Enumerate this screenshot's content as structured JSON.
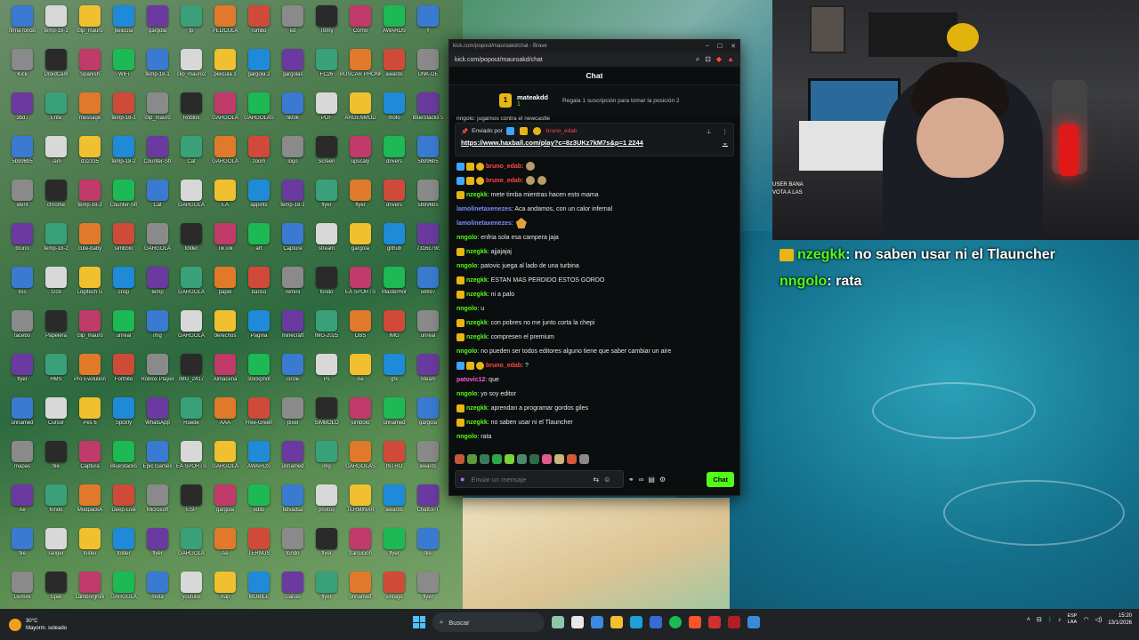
{
  "browser": {
    "title": "kick.com/popout/mauroakd/chat - Brave",
    "url": "kick.com/popout/mauroakd/chat"
  },
  "chat": {
    "header": "Chat",
    "top_gifter": {
      "name": "mateakdd",
      "count": "1",
      "promo": "Regala 1 suscripción para tomar la posición 2"
    },
    "old_line": "nngolo: jugamos contra el newcastle",
    "pinned": {
      "label": "Enviado por",
      "user": "bruno_edab",
      "link": "https://www.haxball.com/play?c=8z3UKz7kM7s&p=1 2244"
    },
    "messages": [
      {
        "user": "bruno_edab",
        "color": "#ff4747",
        "badges": [
          "blue",
          "crown",
          "coin"
        ],
        "text": ":",
        "emote": "emote"
      },
      {
        "user": "bruno_edab",
        "color": "#ff4747",
        "badges": [
          "blue",
          "crown",
          "coin"
        ],
        "text": ":",
        "emote": "emote2x"
      },
      {
        "user": "nzegkk",
        "color": "#53fc18",
        "badges": [
          "crown"
        ],
        "text": ": mete timba mientras hacen esto mama",
        "emote": ""
      },
      {
        "user": "lamolinetaxenezes",
        "color": "#7b8cff",
        "badges": [],
        "text": ": Aca andamos, con un calor infernal",
        "emote": ""
      },
      {
        "user": "lamolinetaxenezes",
        "color": "#7b8cff",
        "badges": [],
        "text": ":",
        "emote": "bird"
      },
      {
        "user": "nngolo",
        "color": "#53fc18",
        "badges": [],
        "text": ": enfria sola esa campera jaja",
        "emote": ""
      },
      {
        "user": "nzegkk",
        "color": "#53fc18",
        "badges": [
          "crown"
        ],
        "text": ": ajjajajaj",
        "emote": ""
      },
      {
        "user": "nngolo",
        "color": "#53fc18",
        "badges": [],
        "text": ": patovic juega al lado de una turbina",
        "emote": ""
      },
      {
        "user": "nzegkk",
        "color": "#53fc18",
        "badges": [
          "crown"
        ],
        "text": ": ESTAN MAS PERDIDO ESTOS GORDO",
        "emote": ""
      },
      {
        "user": "nzegkk",
        "color": "#53fc18",
        "badges": [
          "crown"
        ],
        "text": ": ni a palo",
        "emote": ""
      },
      {
        "user": "nngolo",
        "color": "#53fc18",
        "badges": [],
        "text": ": u",
        "emote": ""
      },
      {
        "user": "nzegkk",
        "color": "#53fc18",
        "badges": [
          "crown"
        ],
        "text": ": con pobres no me junto corta la chepi",
        "emote": ""
      },
      {
        "user": "nzegkk",
        "color": "#53fc18",
        "badges": [
          "crown"
        ],
        "text": ": compresen el premium",
        "emote": ""
      },
      {
        "user": "nngolo",
        "color": "#53fc18",
        "badges": [],
        "text": ": no pueden ser todos editores alguno tiene que saber cambiar un aire",
        "emote": ""
      },
      {
        "user": "bruno_edab",
        "color": "#ff4747",
        "badges": [
          "blue",
          "crown",
          "coin"
        ],
        "text": ": ?",
        "emote": ""
      },
      {
        "user": "patovic12",
        "color": "#ff5bd7",
        "badges": [],
        "text": ": que",
        "emote": ""
      },
      {
        "user": "nngolo",
        "color": "#53fc18",
        "badges": [],
        "text": ": yo soy editor",
        "emote": ""
      },
      {
        "user": "nzegkk",
        "color": "#53fc18",
        "badges": [
          "crown"
        ],
        "text": ": aprendan a programar gordos giles",
        "emote": ""
      },
      {
        "user": "nzegkk",
        "color": "#53fc18",
        "badges": [
          "crown"
        ],
        "text": ": no saben usar ni el Tlauncher",
        "emote": ""
      },
      {
        "user": "nngolo",
        "color": "#53fc18",
        "badges": [],
        "text": ": rata",
        "emote": ""
      }
    ],
    "input_placeholder": "Enviar un mensaje",
    "send_label": "Chat"
  },
  "overlay": [
    {
      "user": "nzegkk",
      "text": ": no saben usar ni el Tlauncher",
      "color": "#53fc18"
    },
    {
      "user": "nngolo",
      "text": ": rata",
      "color": "#53fc18"
    }
  ],
  "webcam_overlay": {
    "line1": "USER BANA",
    "line2": "VOTA A LAS"
  },
  "desktop_icons": [
    "firma fondo",
    "temp-18-1",
    "clip_mauro",
    "pelicula",
    "gargola",
    "tp",
    "PELICULA",
    "rumbo",
    "ed",
    "Tbmy",
    "Corno",
    "AWARDS",
    "Y",
    "Kick",
    "DroidCam",
    "Spanish",
    "WiFi",
    "temp-18-1",
    "clip_mauro2",
    "pelicula 1",
    "gargola 2",
    "gargolas",
    "FC26",
    "BUSCAR PHONK",
    "awards",
    "UNK-DE",
    "3bd7",
    "Ente",
    "message",
    "temp-18-1",
    "clip_mauro",
    "Roblox",
    "GARGOLA",
    "GARGOLAS",
    "tiktok",
    "PDF",
    "ARGENMOD",
    "mofo",
    "BlueStacks 5",
    "5b996b5",
    "Tam",
    "d32335",
    "temp-18-2",
    "Counter-Str",
    "Cat",
    "GARGOLA",
    "zoom",
    "logo",
    "Screen",
    "upscaly",
    "drivers",
    "5b996b5",
    "ident",
    "chrome",
    "temp-18-2",
    "Counter-Str",
    "Cat",
    "GARGOLA",
    "EA",
    "appintx",
    "temp-18-1",
    "flyer",
    "flyer",
    "drivers",
    "5b996b5",
    "bruno",
    "temp-18-2",
    "cute-baby",
    "simbolo",
    "GARGOLA",
    "folder",
    "TikTok",
    "art",
    "Capture",
    "stream",
    "gargola",
    "github",
    "7316c79c",
    "tixs",
    "f2c8",
    "Logitech G",
    "crisp",
    "temp",
    "GARGOLA",
    "papel",
    "banco",
    "remini",
    "fondo",
    "EA SPORTS",
    "MasterHor",
    "58697",
    "tacebo",
    "Papelera",
    "clip_mauro",
    "unreal",
    "img",
    "GARGOLA",
    "derechos",
    "Pagina",
    "minecraft",
    "IMG-2025",
    "OBS",
    "IMG",
    "unreal",
    "flyer",
    "HMS",
    "Pro Evolution",
    "Fortnite",
    "Roblox Player",
    "IMG_2417",
    "Almacena",
    "stockphot",
    "circle",
    "Ps",
    "Ae",
    "gfx",
    "Steam",
    "unnamed",
    "Cursor",
    "Pes 6",
    "Spotify",
    "WhatsApp",
    "Ruede",
    "AAA",
    "Free-Green",
    "pixel",
    "SIMBOLO",
    "simbolo",
    "unnamed",
    "gargola",
    "mapas",
    "file",
    "Captura",
    "BlueStacks",
    "Epic Games",
    "EA SPORTS",
    "GARGOLA",
    "AWARDS",
    "unnamed",
    "img",
    "GARGOLAS",
    "INTRO",
    "awards",
    "Ae",
    "fondo",
    "ModpackA",
    "Deep-Live",
    "Microsoft",
    "ESP",
    "gargola",
    "edits",
    "bdvadsa",
    "photos",
    "TERMINAR",
    "awards",
    "ChatGPT",
    "file",
    "ranger",
    "folder",
    "folder",
    "flyer",
    "GARGOLA",
    "Ae",
    "TERNUS",
    "fondo",
    "flyer",
    "transicion",
    "flyer",
    "file",
    "Gemini",
    "Spar",
    "Lamborghini",
    "GARGOLA",
    "meta",
    "youtube",
    "Rap",
    "MOBILE",
    "Ganas",
    "flyer",
    "unnamed",
    "vintage",
    "flyer",
    "flyer_AME",
    "black-back",
    "MSI",
    "flyer",
    "HMS",
    "flyer",
    "flyer",
    "R",
    "TDE",
    "logo",
    "mecha",
    "flyer",
    "GARGOLAS"
  ],
  "taskbar": {
    "weather_temp": "30°C",
    "weather_desc": "Mayorm. soleado",
    "search_placeholder": "Buscar",
    "lang_line1": "ESP",
    "lang_line2": "LAA",
    "time": "15:20",
    "date": "13/1/2026"
  }
}
